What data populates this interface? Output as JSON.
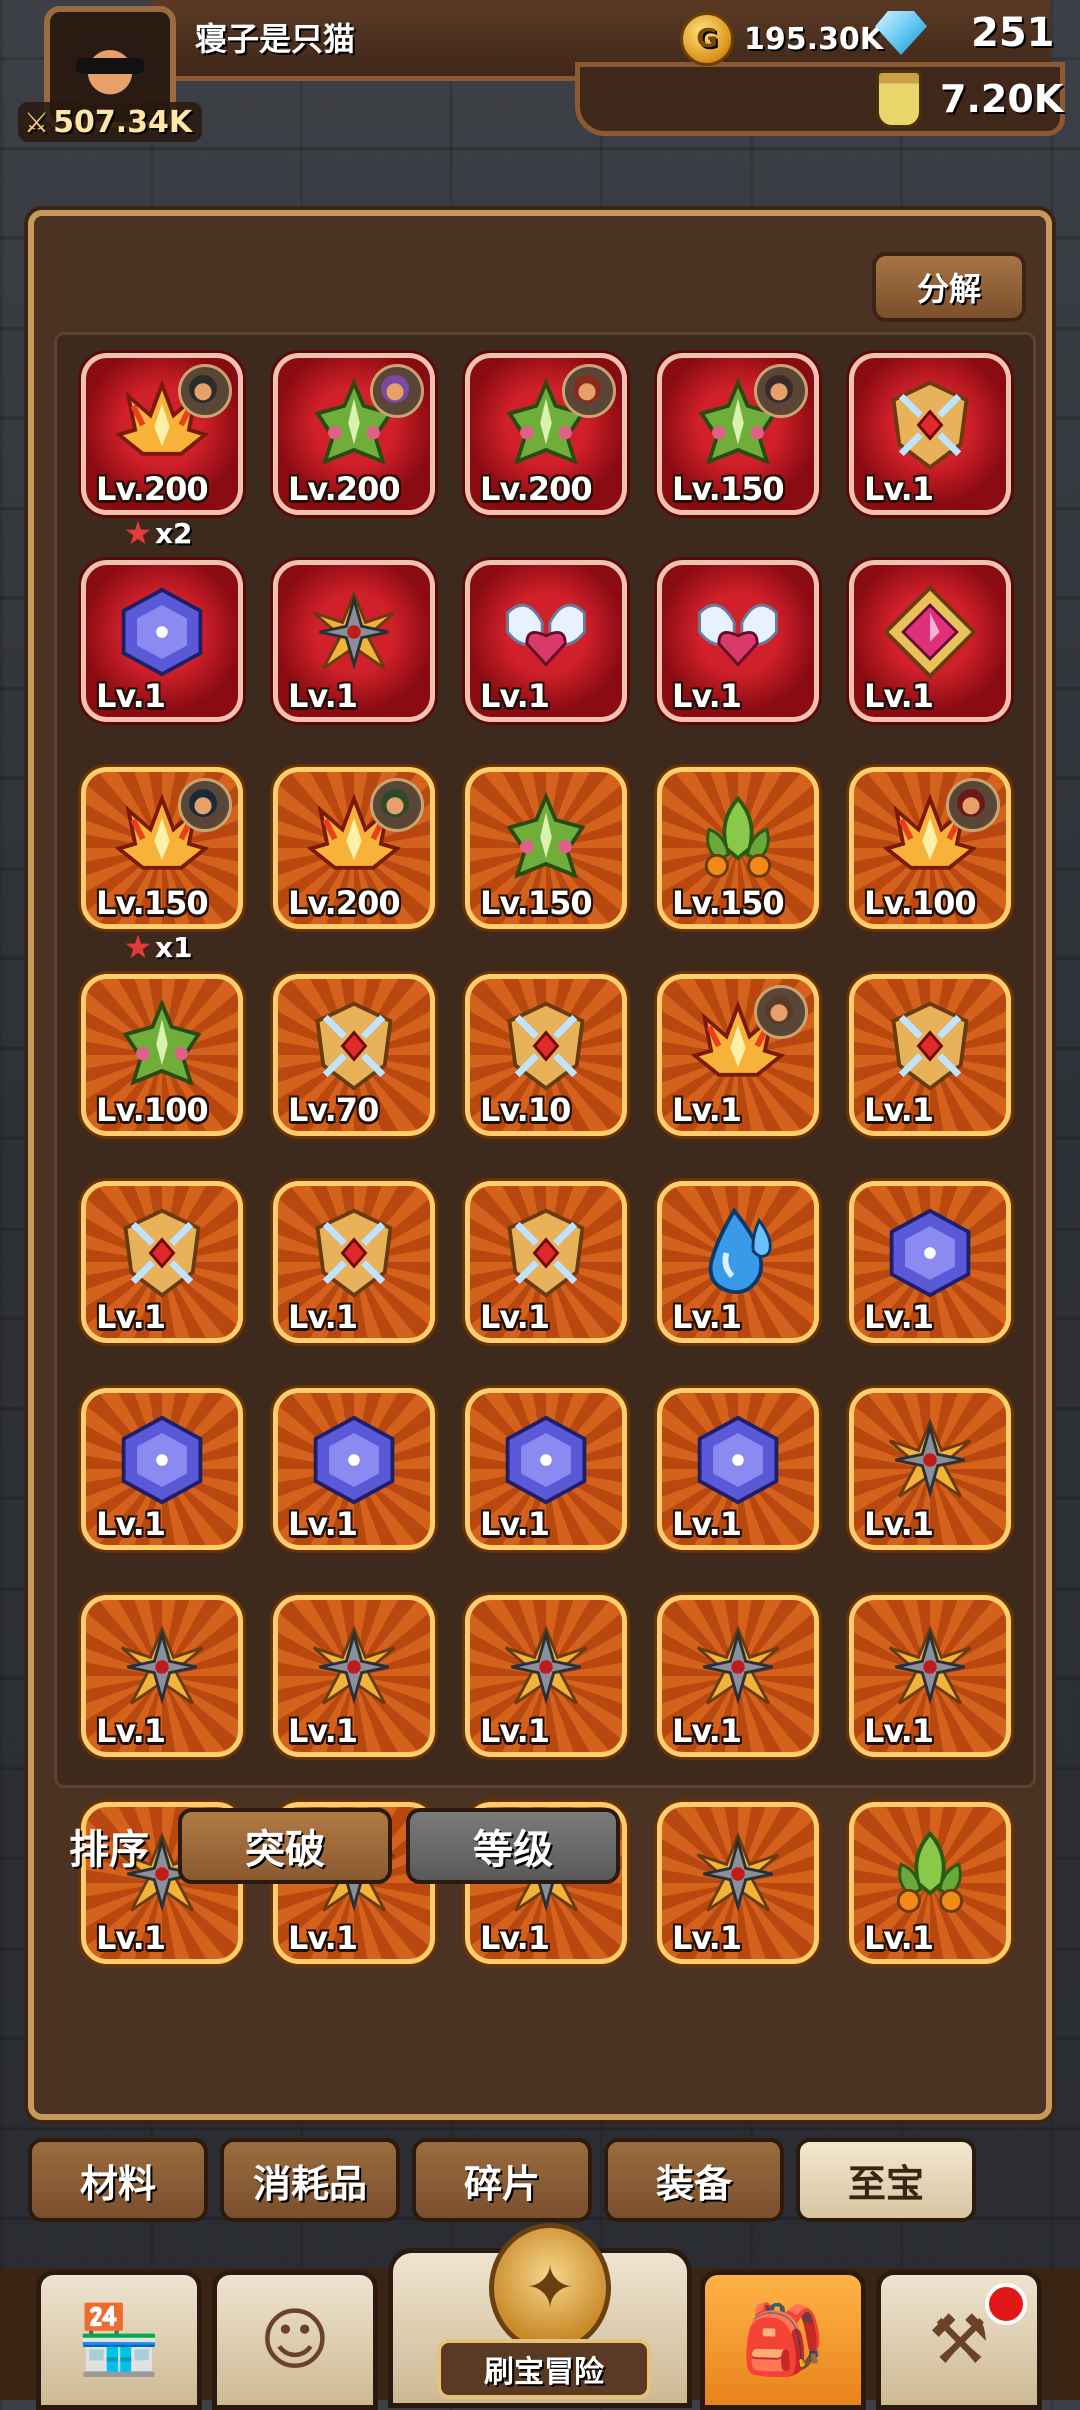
{
  "player": {
    "name": "寝子是只猫",
    "power": "507.34K"
  },
  "resources": {
    "gold": "195.30K",
    "gems": "251",
    "potion": "7.20K"
  },
  "panel": {
    "decompose_label": "分解"
  },
  "items": [
    {
      "level": "Lv.200",
      "rarity": "red",
      "icon": "flame-crown-icon",
      "hero": true,
      "hero_color": "#2b2b2b",
      "stars": "x2"
    },
    {
      "level": "Lv.200",
      "rarity": "red",
      "icon": "thorn-crown-icon",
      "hero": true,
      "hero_color": "#7a4aa0"
    },
    {
      "level": "Lv.200",
      "rarity": "red",
      "icon": "thorn-crown-icon",
      "hero": true,
      "hero_color": "#8a2a1a"
    },
    {
      "level": "Lv.150",
      "rarity": "red",
      "icon": "thorn-crown-icon",
      "hero": true,
      "hero_color": "#3a2a2a"
    },
    {
      "level": "Lv.1",
      "rarity": "red",
      "icon": "shield-emblem-icon",
      "hero": false
    },
    {
      "level": "Lv.1",
      "rarity": "red",
      "icon": "hex-gem-icon",
      "hero": false
    },
    {
      "level": "Lv.1",
      "rarity": "red",
      "icon": "shuriken-icon",
      "hero": false
    },
    {
      "level": "Lv.1",
      "rarity": "red",
      "icon": "winged-heart-icon",
      "hero": false
    },
    {
      "level": "Lv.1",
      "rarity": "red",
      "icon": "winged-heart-icon",
      "hero": false
    },
    {
      "level": "Lv.1",
      "rarity": "red",
      "icon": "pink-gem-icon",
      "hero": false
    },
    {
      "level": "Lv.150",
      "rarity": "orange",
      "icon": "flame-crown-icon",
      "hero": true,
      "hero_color": "#1a2a3a",
      "stars": "x1"
    },
    {
      "level": "Lv.200",
      "rarity": "orange",
      "icon": "flame-crown-icon",
      "hero": true,
      "hero_color": "#2a4a2a"
    },
    {
      "level": "Lv.150",
      "rarity": "orange",
      "icon": "thorn-crown-icon",
      "hero": false
    },
    {
      "level": "Lv.150",
      "rarity": "orange",
      "icon": "leaf-orb-icon",
      "hero": false
    },
    {
      "level": "Lv.100",
      "rarity": "orange",
      "icon": "flame-crown-icon",
      "hero": true,
      "hero_color": "#6a1a1a"
    },
    {
      "level": "Lv.100",
      "rarity": "orange",
      "icon": "thorn-crown-icon",
      "hero": false
    },
    {
      "level": "Lv.70",
      "rarity": "orange",
      "icon": "shield-emblem-icon",
      "hero": false
    },
    {
      "level": "Lv.10",
      "rarity": "orange",
      "icon": "shield-emblem-icon",
      "hero": false
    },
    {
      "level": "Lv.1",
      "rarity": "orange",
      "icon": "flame-crown-icon",
      "hero": true,
      "hero_color": "#5a3a2a"
    },
    {
      "level": "Lv.1",
      "rarity": "orange",
      "icon": "shield-emblem-icon",
      "hero": false
    },
    {
      "level": "Lv.1",
      "rarity": "orange",
      "icon": "shield-emblem-icon",
      "hero": false
    },
    {
      "level": "Lv.1",
      "rarity": "orange",
      "icon": "shield-emblem-icon",
      "hero": false
    },
    {
      "level": "Lv.1",
      "rarity": "orange",
      "icon": "shield-emblem-icon",
      "hero": false
    },
    {
      "level": "Lv.1",
      "rarity": "orange",
      "icon": "water-drop-icon",
      "hero": false
    },
    {
      "level": "Lv.1",
      "rarity": "orange",
      "icon": "hex-gem-icon",
      "hero": false
    },
    {
      "level": "Lv.1",
      "rarity": "orange",
      "icon": "hex-gem-icon",
      "hero": false
    },
    {
      "level": "Lv.1",
      "rarity": "orange",
      "icon": "hex-gem-icon",
      "hero": false
    },
    {
      "level": "Lv.1",
      "rarity": "orange",
      "icon": "hex-gem-icon",
      "hero": false
    },
    {
      "level": "Lv.1",
      "rarity": "orange",
      "icon": "hex-gem-icon",
      "hero": false
    },
    {
      "level": "Lv.1",
      "rarity": "orange",
      "icon": "shuriken-icon",
      "hero": false
    },
    {
      "level": "Lv.1",
      "rarity": "orange",
      "icon": "shuriken-icon",
      "hero": false
    },
    {
      "level": "Lv.1",
      "rarity": "orange",
      "icon": "shuriken-icon",
      "hero": false
    },
    {
      "level": "Lv.1",
      "rarity": "orange",
      "icon": "shuriken-icon",
      "hero": false
    },
    {
      "level": "Lv.1",
      "rarity": "orange",
      "icon": "shuriken-icon",
      "hero": false
    },
    {
      "level": "Lv.1",
      "rarity": "orange",
      "icon": "shuriken-icon",
      "hero": false
    },
    {
      "level": "Lv.1",
      "rarity": "orange",
      "icon": "shuriken-icon",
      "hero": false
    },
    {
      "level": "Lv.1",
      "rarity": "orange",
      "icon": "shuriken-icon",
      "hero": false
    },
    {
      "level": "Lv.1",
      "rarity": "orange",
      "icon": "shuriken-icon",
      "hero": false
    },
    {
      "level": "Lv.1",
      "rarity": "orange",
      "icon": "shuriken-icon",
      "hero": false
    },
    {
      "level": "Lv.1",
      "rarity": "orange",
      "icon": "leaf-orb-icon",
      "hero": false
    }
  ],
  "sort": {
    "label": "排序",
    "buttons": [
      {
        "label": "突破",
        "active": true
      },
      {
        "label": "等级",
        "active": false
      }
    ]
  },
  "tabs": [
    {
      "label": "材料",
      "active": false
    },
    {
      "label": "消耗品",
      "active": false
    },
    {
      "label": "碎片",
      "active": false
    },
    {
      "label": "装备",
      "active": false
    },
    {
      "label": "至宝",
      "active": true
    }
  ],
  "nav": {
    "center_label": "刷宝冒险",
    "buttons": [
      {
        "icon": "shop-icon",
        "active": false
      },
      {
        "icon": "hero-icon",
        "active": false
      },
      {
        "icon": "adventure-map-icon",
        "active": false
      },
      {
        "icon": "backpack-icon",
        "active": true
      },
      {
        "icon": "forge-hammer-icon",
        "active": false,
        "badge": true
      }
    ]
  },
  "colors": {
    "panel_border": "#c79a5c",
    "red_rarity": "#c8101c",
    "orange_rarity": "#d4621c",
    "active_tab": "#f3e7cf"
  }
}
